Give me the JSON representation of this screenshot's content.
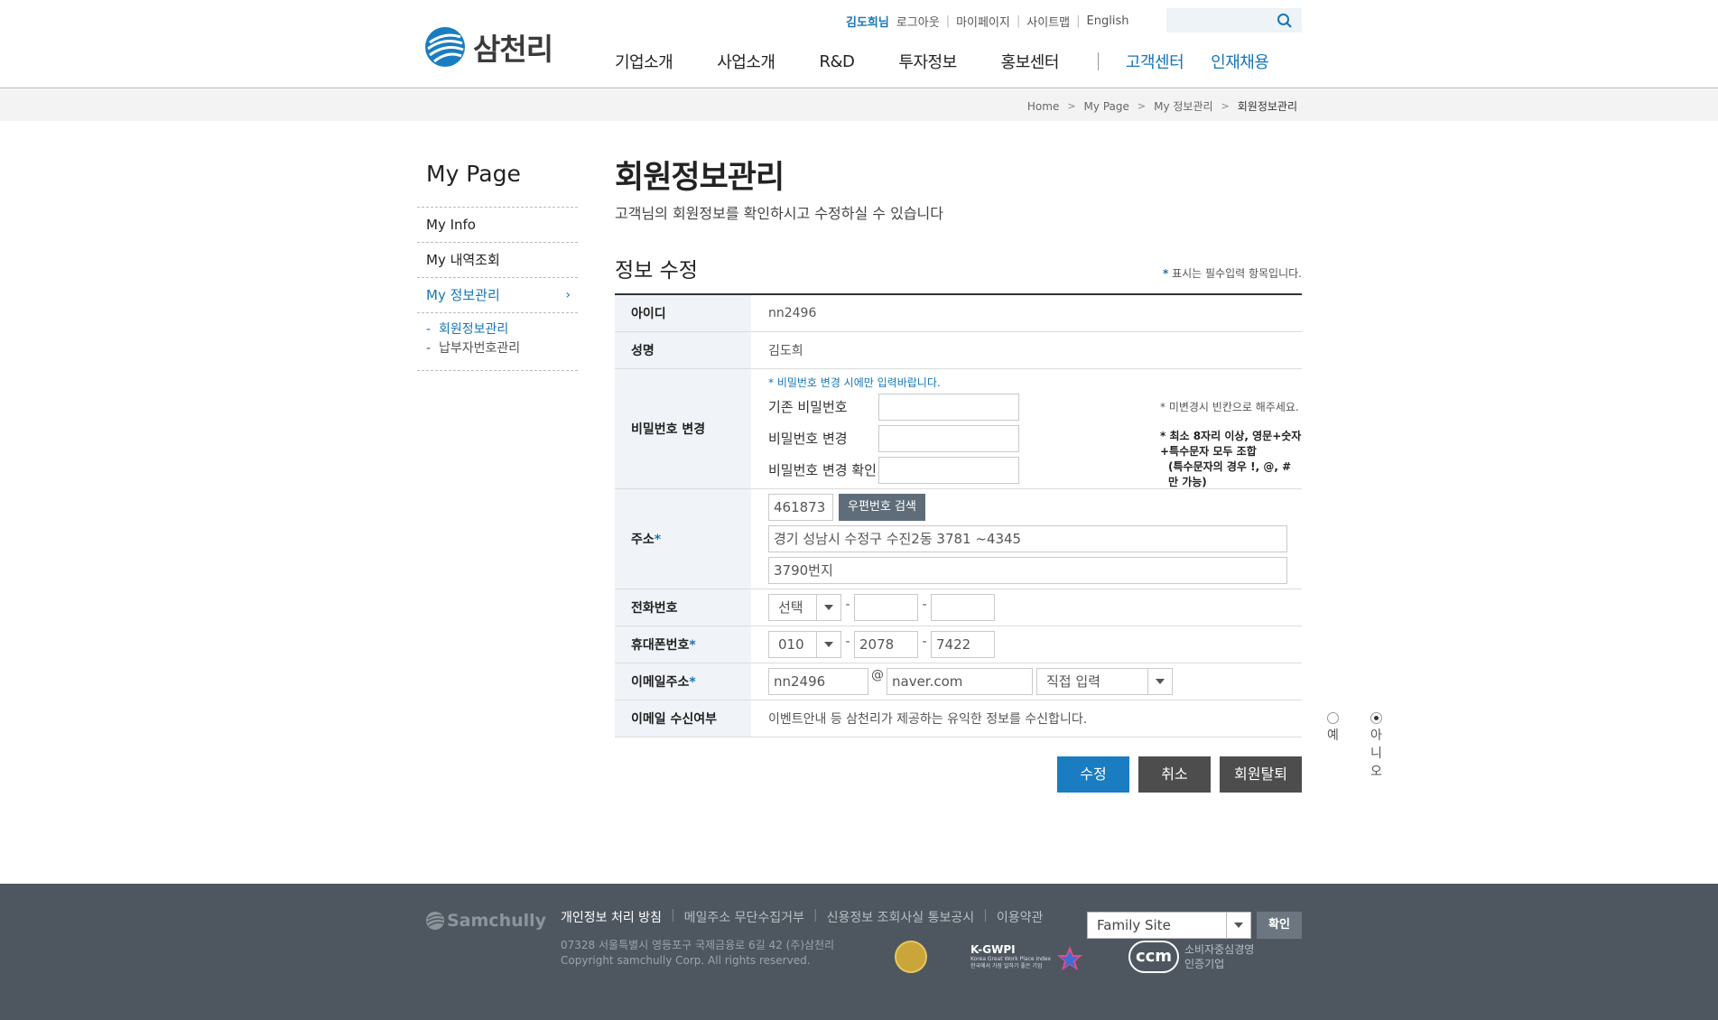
{
  "header": {
    "logo_text": "삼천리",
    "util": {
      "user": "김도희님",
      "logout": "로그아웃",
      "mypage": "마이페이지",
      "sitemap": "사이트맵",
      "english": "English"
    },
    "gnb": [
      "기업소개",
      "사업소개",
      "R&D",
      "투자정보",
      "홍보센터"
    ],
    "gnb_blue": [
      "고객센터",
      "인재채용"
    ]
  },
  "breadcrumb": [
    "Home",
    "My Page",
    "My 정보관리",
    "회원정보관리"
  ],
  "lnb": {
    "title": "My Page",
    "items": [
      "My Info",
      "My 내역조회",
      "My 정보관리"
    ],
    "sub": [
      "회원정보관리",
      "납부자번호관리"
    ],
    "chevron": "›"
  },
  "content": {
    "title": "회원정보관리",
    "desc": "고객님의 회원정보를 확인하시고 수정하실 수 있습니다",
    "section_title": "정보 수정",
    "required_note": "표시는 필수입력 항목입니다.",
    "required_mark": "*"
  },
  "form": {
    "id_label": "아이디",
    "id_value": "nn2496",
    "name_label": "성명",
    "name_value": "김도희",
    "pw_label": "비밀번호 변경",
    "pw_note": "* 비밀번호 변경 시에만 입력바랍니다.",
    "pw_current": "기존 비밀번호",
    "pw_new": "비밀번호 변경",
    "pw_confirm": "비밀번호 변경 확인",
    "pw_hint1": "* 미변경시 빈칸으로 해주세요.",
    "pw_hint2a": "* 최소 8자리 이상, 영문+숫자+특수문자 모두 조합",
    "pw_hint2b": "(특수문자의 경우 !, @, # 만 가능)",
    "addr_label": "주소",
    "zip": "461873",
    "zip_button": "우편번호 검색",
    "addr1": "경기 성남시 수정구 수진2동 3781 ~4345",
    "addr2": "3790번지",
    "tel_label": "전화번호",
    "tel_select": "선택",
    "mobile_label": "휴대폰번호",
    "mobile1": "010",
    "mobile2": "2078",
    "mobile3": "7422",
    "email_label": "이메일주소",
    "email_id": "nn2496",
    "email_at": "@",
    "email_domain": "naver.com",
    "email_select": "직접 입력",
    "receive_label": "이메일 수신여부",
    "receive_text": "이벤트안내 등 삼천리가 제공하는 유익한 정보를 수신합니다.",
    "receive_yes": "예",
    "receive_no": "아니오",
    "dash": "-"
  },
  "buttons": {
    "submit": "수정",
    "cancel": "취소",
    "withdraw": "회원탈퇴"
  },
  "footer": {
    "logo": "Samchully",
    "links": [
      "개인정보 처리 방침",
      "메일주소 무단수집거부",
      "신용정보 조회사실 통보공시",
      "이용약관"
    ],
    "address": "07328 서울특별시 영등포구 국제금융로 6길 42 (주)삼천리",
    "copyright": "Copyright samchully Corp. All rights reserved.",
    "family_site": "Family Site",
    "family_ok": "확인",
    "kgwpi": "K-GWPI",
    "kgwpi_sub1": "Korea Great Work Place Index",
    "kgwpi_sub2": "한국에서 가장 일하기 좋은 기업",
    "ccm": "ccm",
    "ccm_text1": "소비자중심경영",
    "ccm_text2": "인증기업"
  },
  "colors": {
    "accent": "#1676b6",
    "footer_bg": "#4e5760",
    "btn_dark": "#4d4d4d"
  }
}
